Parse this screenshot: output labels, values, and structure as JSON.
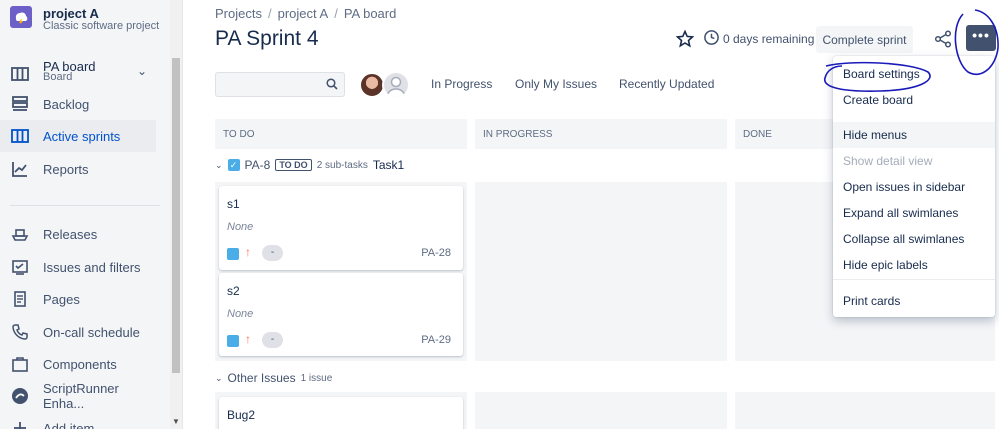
{
  "sidebar": {
    "project_name": "project A",
    "project_type": "Classic software project",
    "items": [
      {
        "label": "PA board",
        "sub": "Board"
      },
      {
        "label": "Backlog"
      },
      {
        "label": "Active sprints"
      },
      {
        "label": "Reports"
      },
      {
        "label": "Releases"
      },
      {
        "label": "Issues and filters"
      },
      {
        "label": "Pages"
      },
      {
        "label": "On-call schedule"
      },
      {
        "label": "Components"
      },
      {
        "label": "ScriptRunner Enha..."
      },
      {
        "label": "Add item"
      }
    ]
  },
  "header": {
    "breadcrumb": [
      "Projects",
      "project A",
      "PA board"
    ],
    "title": "PA Sprint 4",
    "days_remaining": "0 days remaining",
    "complete_sprint": "Complete sprint",
    "more_label": "•••"
  },
  "filters": {
    "search_placeholder": "",
    "quick_filters": [
      "In Progress",
      "Only My Issues",
      "Recently Updated"
    ]
  },
  "board": {
    "columns": [
      "TO DO",
      "IN PROGRESS",
      "DONE"
    ],
    "swimlane": {
      "key": "PA-8",
      "status": "TO DO",
      "subtasks": "2 sub-tasks",
      "name": "Task1"
    },
    "cards": [
      {
        "title": "s1",
        "assignee": "None",
        "pill": "-",
        "key": "PA-28"
      },
      {
        "title": "s2",
        "assignee": "None",
        "pill": "-",
        "key": "PA-29"
      }
    ],
    "other_lane": {
      "label": "Other Issues",
      "count": "1 issue"
    },
    "bug_card": {
      "title": "Bug2"
    }
  },
  "menu": {
    "items": [
      {
        "label": "Board settings",
        "state": "normal"
      },
      {
        "label": "Create board",
        "state": "normal"
      },
      {
        "label": "Hide menus",
        "state": "hover"
      },
      {
        "label": "Show detail view",
        "state": "disabled"
      },
      {
        "label": "Open issues in sidebar",
        "state": "normal"
      },
      {
        "label": "Expand all swimlanes",
        "state": "normal"
      },
      {
        "label": "Collapse all swimlanes",
        "state": "normal"
      },
      {
        "label": "Hide epic labels",
        "state": "normal"
      },
      {
        "label": "Print cards",
        "state": "normal"
      }
    ]
  },
  "colors": {
    "accent": "#0052cc",
    "annotation": "#1a1ab8",
    "more_button": "#42526e"
  }
}
